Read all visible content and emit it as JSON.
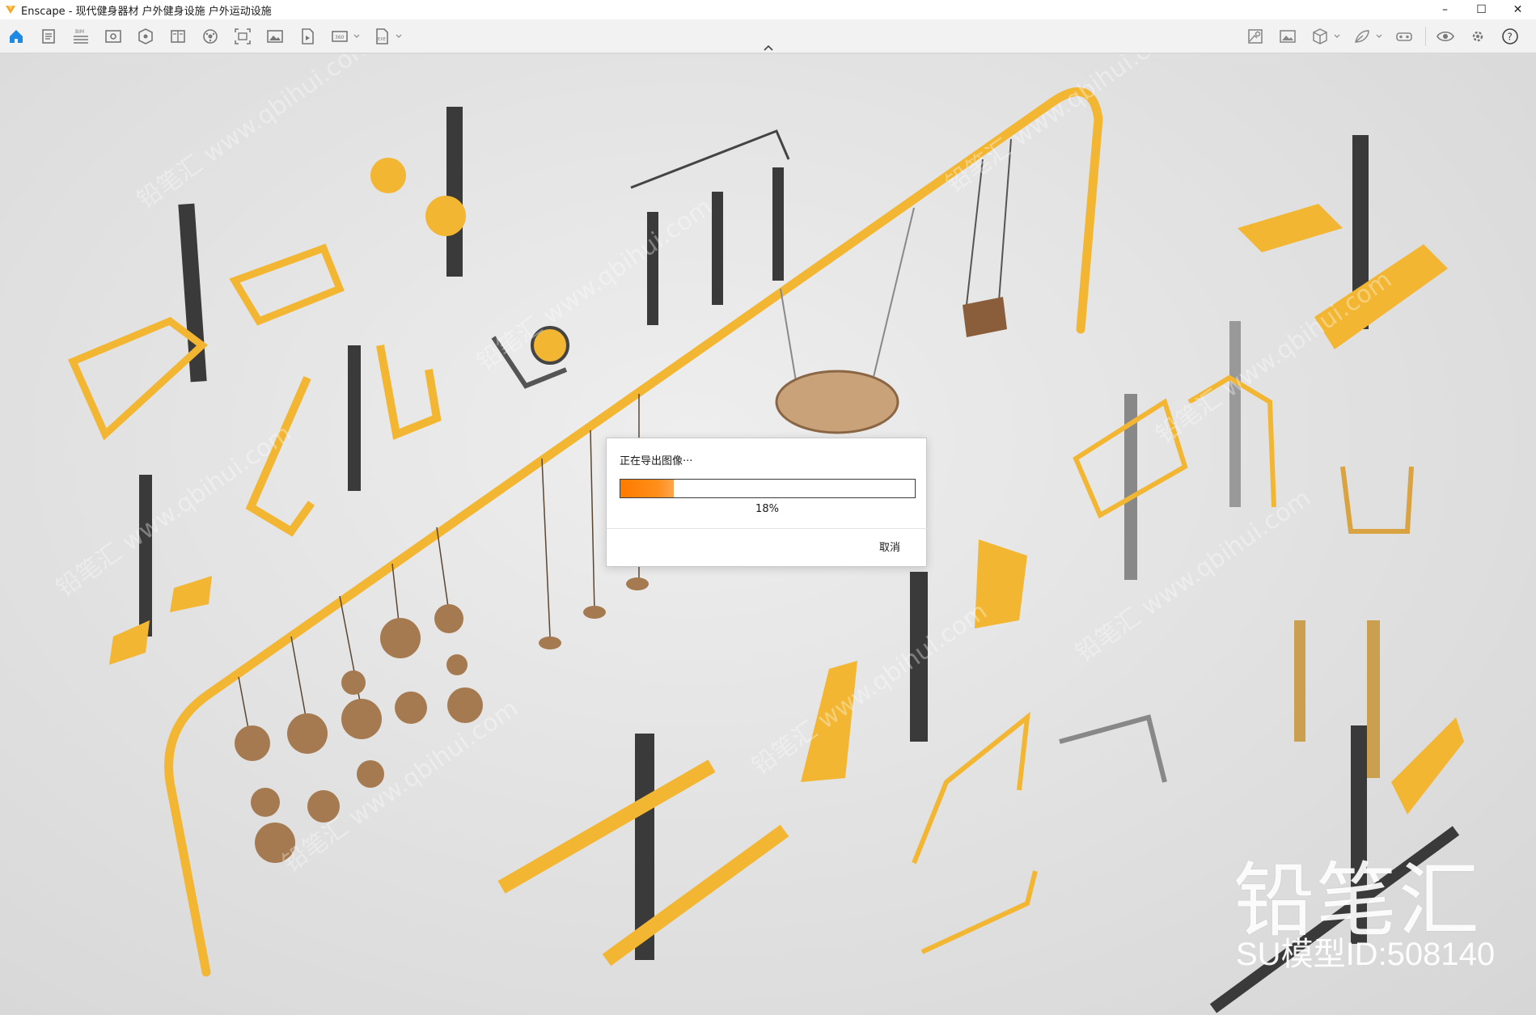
{
  "window": {
    "app_name": "Enscape",
    "title": "Enscape - 现代健身器材 户外健身设施 户外运动设施",
    "controls": {
      "minimize": "–",
      "maximize": "☐",
      "close": "✕"
    }
  },
  "toolbar": {
    "left_icons": [
      "home-icon",
      "document-icon",
      "bim-icon",
      "view-icon",
      "asset-icon",
      "book-icon",
      "settings-wheel-icon",
      "screenshot-icon",
      "image-icon",
      "video-icon",
      "panorama-icon",
      "exe-export-icon"
    ],
    "right_icons": [
      "map-icon",
      "gallery-icon",
      "cube-icon",
      "leaf-icon",
      "vr-headset-icon",
      "eye-icon",
      "gear-icon",
      "help-icon"
    ],
    "bim_label": "BIM",
    "panorama_label": "360",
    "exe_label": "EXE",
    "help_label": "?",
    "collapse_glyph": "^"
  },
  "dialog": {
    "title": "正在导出图像···",
    "progress": 0.18,
    "progress_label": "18%",
    "cancel_label": "取消"
  },
  "watermark": {
    "brand": "铅笔汇",
    "model_id": "SU模型ID:508140",
    "tile_text": "铅笔汇 www.qbihui.com"
  },
  "colors": {
    "accent": "#1e88e5",
    "progress": "#ff7a00",
    "equipment_yellow": "#f2b632",
    "post_dark": "#3a3a3a"
  }
}
